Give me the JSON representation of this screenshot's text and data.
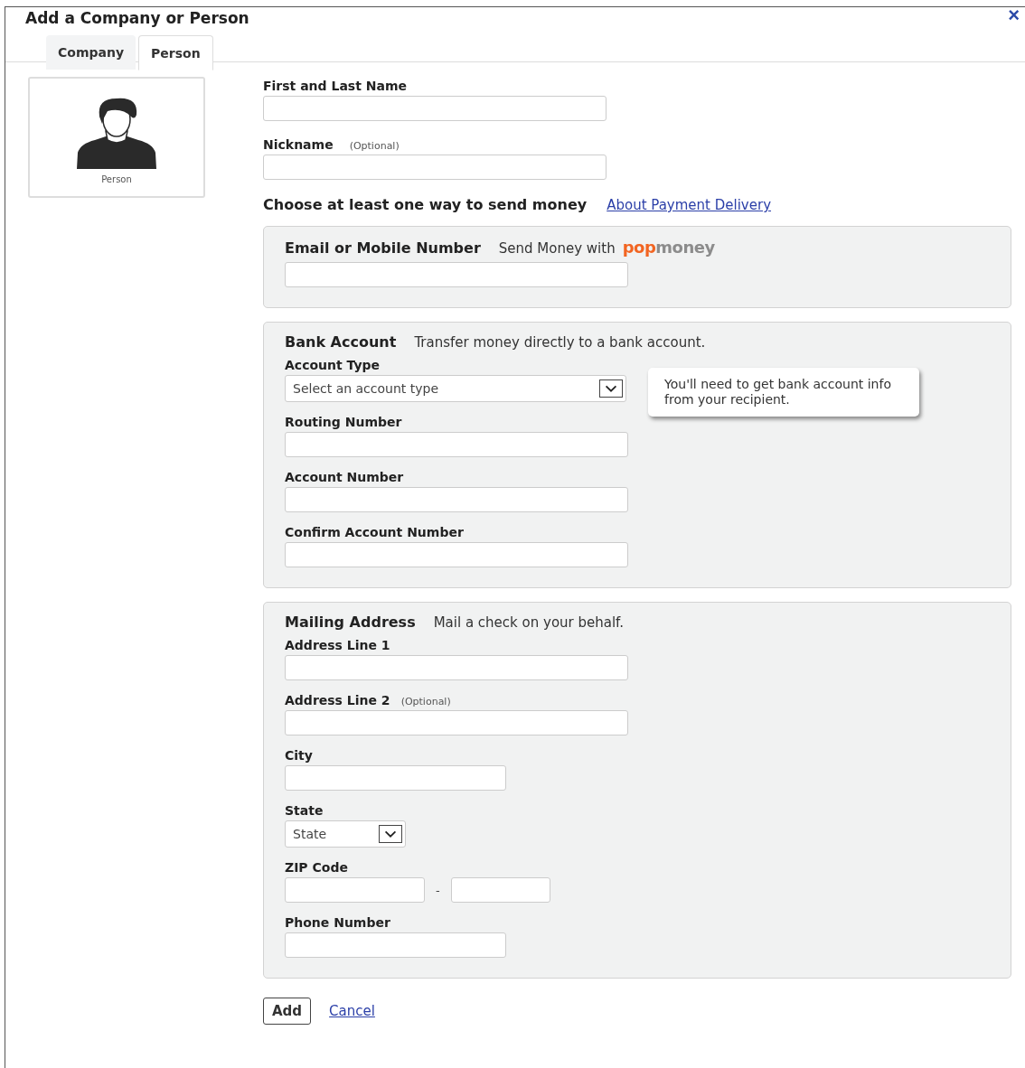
{
  "window": {
    "title": "Add a Company or Person",
    "close": "×"
  },
  "tabs": [
    {
      "label": "Company",
      "selected": false
    },
    {
      "label": "Person",
      "selected": true
    }
  ],
  "avatar": {
    "caption": "Person"
  },
  "name_fields": [
    {
      "label": "First and Last Name",
      "kind": "input"
    },
    {
      "label": "Nickname",
      "hint": "(Optional)",
      "kind": "input"
    }
  ],
  "send_prompt": {
    "text": "Choose at least one way to send money",
    "link": "About Payment Delivery"
  },
  "sections": [
    {
      "title": "Email or Mobile Number",
      "subtitle": "Send Money with",
      "logo": [
        {
          "text": "pop",
          "color": "#f26522"
        },
        {
          "text": "money",
          "color": "#8c8c8c"
        }
      ],
      "fields": [
        {
          "kind": "input"
        }
      ]
    },
    {
      "title": "Bank Account",
      "subtitle": "Transfer money directly to a bank account.",
      "note": "You'll need to get bank account info from your recipient.",
      "fields": [
        {
          "label": "Account Type",
          "kind": "select",
          "value": "Select an account type"
        },
        {
          "label": "Routing Number",
          "kind": "input"
        },
        {
          "label": "Account Number",
          "kind": "input"
        },
        {
          "label": "Confirm Account Number",
          "kind": "input"
        }
      ]
    },
    {
      "title": "Mailing Address",
      "subtitle": "Mail a check on your behalf.",
      "fields": [
        {
          "label": "Address Line 1",
          "kind": "input"
        },
        {
          "label": "Address Line 2",
          "hint": "(Optional)",
          "kind": "input"
        },
        {
          "label": "City",
          "kind": "short-input"
        },
        {
          "label": "State",
          "kind": "small-select",
          "value": "State"
        },
        {
          "label": "ZIP Code",
          "kind": "zip",
          "separator": "-"
        },
        {
          "label": "Phone Number",
          "kind": "short-input"
        }
      ]
    }
  ],
  "buttons": {
    "primary": "Add",
    "link": "Cancel"
  }
}
